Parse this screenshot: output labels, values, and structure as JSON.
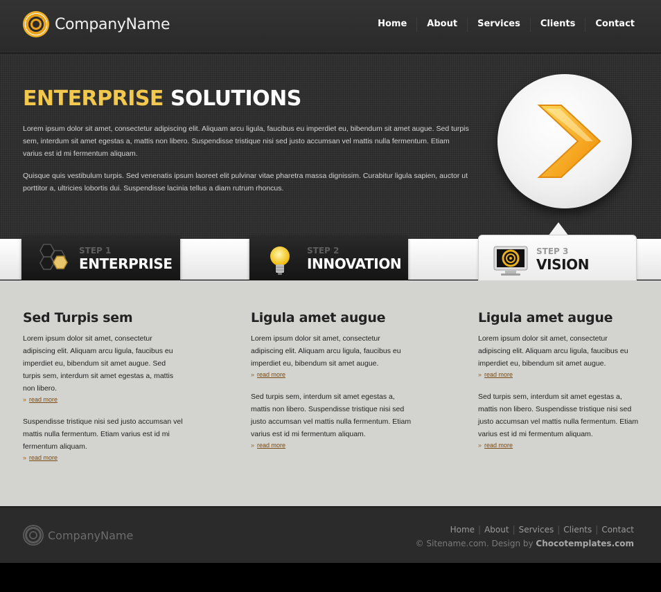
{
  "header": {
    "logo_text": "CompanyName",
    "nav": [
      "Home",
      "About",
      "Services",
      "Clients",
      "Contact"
    ]
  },
  "hero": {
    "title_highlight": "ENTERPRISE",
    "title_rest": "SOLUTIONS",
    "para1": "Lorem ipsum dolor sit amet, consectetur adipiscing elit. Aliquam arcu ligula, faucibus eu imperdiet eu, bibendum sit amet augue. Sed turpis sem, interdum sit amet egestas a, mattis non libero. Suspendisse tristique nisi sed justo accumsan vel mattis nulla fermentum. Etiam varius est id mi fermentum aliquam.",
    "para2": "Quisque quis vestibulum turpis. Sed venenatis ipsum laoreet elit pulvinar vitae pharetra massa dignissim. Curabitur ligula sapien, auctor ut porttitor a, ultricies lobortis dui. Suspendisse lacinia tellus a diam rutrum rhoncus.",
    "button_icon": "chevron-right-icon"
  },
  "steps": [
    {
      "num": "STEP 1",
      "name": "ENTERPRISE",
      "icon": "hexagons-icon"
    },
    {
      "num": "STEP 2",
      "name": "INNOVATION",
      "icon": "lightbulb-icon"
    },
    {
      "num": "STEP 3",
      "name": "VISION",
      "icon": "monitor-icon"
    }
  ],
  "columns": [
    {
      "title": "Sed Turpis sem",
      "p1": "Lorem ipsum dolor sit amet, consectetur adipiscing elit. Aliquam arcu ligula, faucibus eu imperdiet eu, bibendum sit amet augue. Sed turpis sem, interdum sit amet egestas a, mattis non libero.",
      "p2": "Suspendisse tristique nisi sed justo accumsan vel mattis nulla fermentum. Etiam varius est id mi fermentum aliquam."
    },
    {
      "title": "Ligula amet augue",
      "p1": "Lorem ipsum dolor sit amet, consectetur adipiscing elit. Aliquam arcu ligula, faucibus eu imperdiet eu, bibendum sit amet augue.",
      "p2": "Sed turpis sem, interdum sit amet egestas a, mattis non libero. Suspendisse tristique nisi sed justo accumsan vel mattis nulla fermentum. Etiam varius est id mi fermentum aliquam."
    },
    {
      "title": "Ligula amet augue",
      "p1": "Lorem ipsum dolor sit amet, consectetur adipiscing elit. Aliquam arcu ligula, faucibus eu imperdiet eu, bibendum sit amet augue.",
      "p2": "Sed turpis sem, interdum sit amet egestas a, mattis non libero. Suspendisse tristique nisi sed justo accumsan vel mattis nulla fermentum. Etiam varius est id mi fermentum aliquam."
    }
  ],
  "read_more": "read more",
  "read_more_arrow": "»",
  "footer": {
    "logo_text": "CompanyName",
    "nav": [
      "Home",
      "About",
      "Services",
      "Clients",
      "Contact"
    ],
    "nav_separator": "|",
    "copy_prefix": "© Sitename.com.",
    "design_by": "Design by",
    "designer": "Chocotemplates.com"
  },
  "colors": {
    "accent": "#f2c94c",
    "header_bg": "#2f2f2f",
    "content_bg": "#d3d4cf",
    "link_brown": "#7a4a14"
  }
}
